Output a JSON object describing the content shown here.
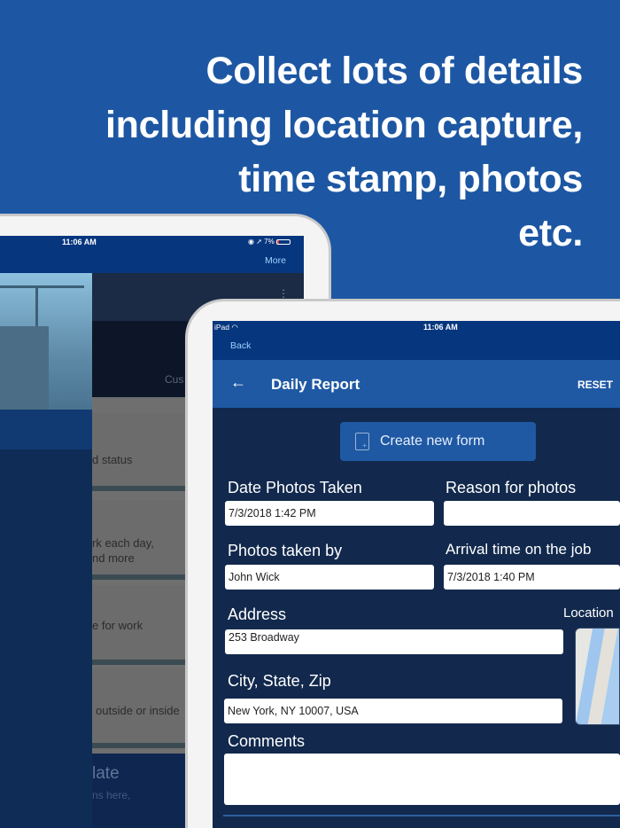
{
  "headline": {
    "lines": [
      "Collect lots of details",
      "including location capture,",
      "time stamp, photos",
      "etc."
    ]
  },
  "back_device": {
    "status_time": "11:06 AM",
    "battery": "7%",
    "nav_more": "More",
    "tile_label": "Cus",
    "cards": [
      "d status",
      "rk each day,",
      "nd more",
      "e for work",
      "outside or inside"
    ],
    "template_title": "late",
    "template_sub": "ns here,"
  },
  "front_device": {
    "status_device": "iPad",
    "status_time": "11:06 AM",
    "back_label": "Back",
    "title": "Daily Report",
    "reset_label": "RESET",
    "create_button": "Create new form",
    "fields": {
      "date_photos": {
        "label": "Date Photos Taken",
        "value": "7/3/2018 1:42 PM"
      },
      "reason": {
        "label": "Reason for photos",
        "value": ""
      },
      "taken_by": {
        "label": "Photos taken by",
        "value": "John Wick"
      },
      "arrival": {
        "label": "Arrival time on the job",
        "value": "7/3/2018 1:40 PM"
      },
      "address": {
        "label": "Address",
        "value": "253 Broadway"
      },
      "location": {
        "label": "Location"
      },
      "city": {
        "label": "City, State, Zip",
        "value": "New York, NY 10007, USA"
      },
      "comments": {
        "label": "Comments",
        "value": ""
      }
    }
  }
}
